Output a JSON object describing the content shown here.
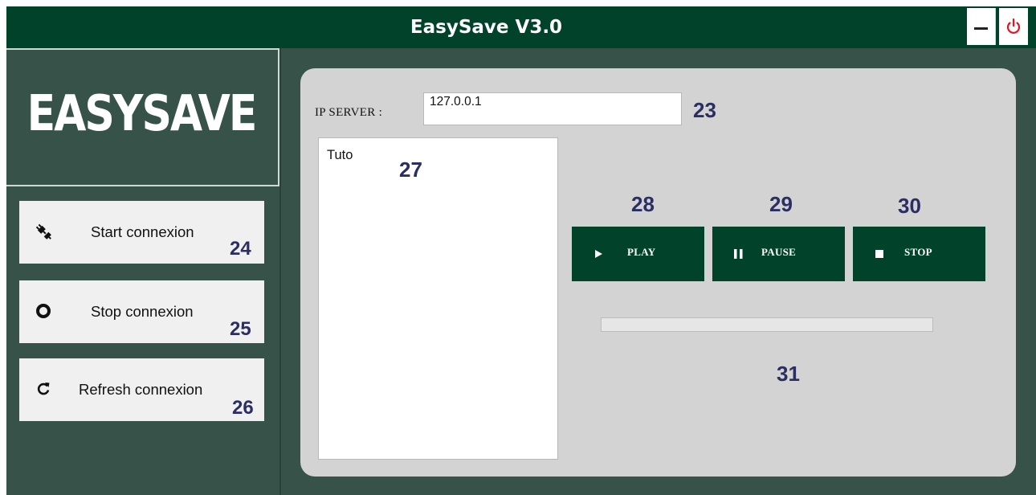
{
  "window": {
    "title": "EasySave V3.0"
  },
  "sidebar": {
    "logo": "EASYSAVE",
    "buttons": [
      {
        "label": "Start connexion",
        "marker": "24",
        "icon": "plug-icon"
      },
      {
        "label": "Stop connexion",
        "marker": "25",
        "icon": "stop-circle-icon"
      },
      {
        "label": "Refresh connexion",
        "marker": "26",
        "icon": "refresh-icon"
      }
    ]
  },
  "main": {
    "ip_label": "IP SERVER :",
    "ip_value": "127.0.0.1",
    "ip_marker": "23",
    "list": {
      "items": [
        "Tuto"
      ],
      "marker": "27"
    },
    "controls": [
      {
        "label": "PLAY",
        "marker": "28",
        "icon": "play-icon"
      },
      {
        "label": "PAUSE",
        "marker": "29",
        "icon": "pause-icon"
      },
      {
        "label": "STOP",
        "marker": "30",
        "icon": "stop-icon"
      }
    ],
    "progress": {
      "value": 0,
      "marker": "31"
    }
  },
  "colors": {
    "titlebar": "#00432a",
    "background": "#375248",
    "panel": "#d3d3d3",
    "control_button": "#00432a",
    "marker_text": "#2b2e63",
    "power_icon": "#e81123"
  }
}
